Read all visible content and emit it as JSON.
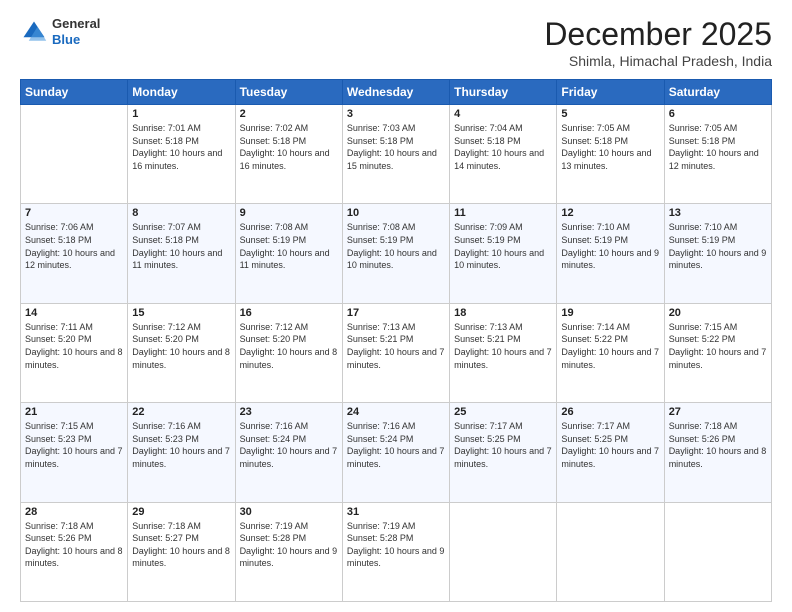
{
  "logo": {
    "general": "General",
    "blue": "Blue"
  },
  "header": {
    "month": "December 2025",
    "location": "Shimla, Himachal Pradesh, India"
  },
  "days_of_week": [
    "Sunday",
    "Monday",
    "Tuesday",
    "Wednesday",
    "Thursday",
    "Friday",
    "Saturday"
  ],
  "weeks": [
    [
      {
        "day": "",
        "sunrise": "",
        "sunset": "",
        "daylight": ""
      },
      {
        "day": "1",
        "sunrise": "Sunrise: 7:01 AM",
        "sunset": "Sunset: 5:18 PM",
        "daylight": "Daylight: 10 hours and 16 minutes."
      },
      {
        "day": "2",
        "sunrise": "Sunrise: 7:02 AM",
        "sunset": "Sunset: 5:18 PM",
        "daylight": "Daylight: 10 hours and 16 minutes."
      },
      {
        "day": "3",
        "sunrise": "Sunrise: 7:03 AM",
        "sunset": "Sunset: 5:18 PM",
        "daylight": "Daylight: 10 hours and 15 minutes."
      },
      {
        "day": "4",
        "sunrise": "Sunrise: 7:04 AM",
        "sunset": "Sunset: 5:18 PM",
        "daylight": "Daylight: 10 hours and 14 minutes."
      },
      {
        "day": "5",
        "sunrise": "Sunrise: 7:05 AM",
        "sunset": "Sunset: 5:18 PM",
        "daylight": "Daylight: 10 hours and 13 minutes."
      },
      {
        "day": "6",
        "sunrise": "Sunrise: 7:05 AM",
        "sunset": "Sunset: 5:18 PM",
        "daylight": "Daylight: 10 hours and 12 minutes."
      }
    ],
    [
      {
        "day": "7",
        "sunrise": "Sunrise: 7:06 AM",
        "sunset": "Sunset: 5:18 PM",
        "daylight": "Daylight: 10 hours and 12 minutes."
      },
      {
        "day": "8",
        "sunrise": "Sunrise: 7:07 AM",
        "sunset": "Sunset: 5:18 PM",
        "daylight": "Daylight: 10 hours and 11 minutes."
      },
      {
        "day": "9",
        "sunrise": "Sunrise: 7:08 AM",
        "sunset": "Sunset: 5:19 PM",
        "daylight": "Daylight: 10 hours and 11 minutes."
      },
      {
        "day": "10",
        "sunrise": "Sunrise: 7:08 AM",
        "sunset": "Sunset: 5:19 PM",
        "daylight": "Daylight: 10 hours and 10 minutes."
      },
      {
        "day": "11",
        "sunrise": "Sunrise: 7:09 AM",
        "sunset": "Sunset: 5:19 PM",
        "daylight": "Daylight: 10 hours and 10 minutes."
      },
      {
        "day": "12",
        "sunrise": "Sunrise: 7:10 AM",
        "sunset": "Sunset: 5:19 PM",
        "daylight": "Daylight: 10 hours and 9 minutes."
      },
      {
        "day": "13",
        "sunrise": "Sunrise: 7:10 AM",
        "sunset": "Sunset: 5:19 PM",
        "daylight": "Daylight: 10 hours and 9 minutes."
      }
    ],
    [
      {
        "day": "14",
        "sunrise": "Sunrise: 7:11 AM",
        "sunset": "Sunset: 5:20 PM",
        "daylight": "Daylight: 10 hours and 8 minutes."
      },
      {
        "day": "15",
        "sunrise": "Sunrise: 7:12 AM",
        "sunset": "Sunset: 5:20 PM",
        "daylight": "Daylight: 10 hours and 8 minutes."
      },
      {
        "day": "16",
        "sunrise": "Sunrise: 7:12 AM",
        "sunset": "Sunset: 5:20 PM",
        "daylight": "Daylight: 10 hours and 8 minutes."
      },
      {
        "day": "17",
        "sunrise": "Sunrise: 7:13 AM",
        "sunset": "Sunset: 5:21 PM",
        "daylight": "Daylight: 10 hours and 7 minutes."
      },
      {
        "day": "18",
        "sunrise": "Sunrise: 7:13 AM",
        "sunset": "Sunset: 5:21 PM",
        "daylight": "Daylight: 10 hours and 7 minutes."
      },
      {
        "day": "19",
        "sunrise": "Sunrise: 7:14 AM",
        "sunset": "Sunset: 5:22 PM",
        "daylight": "Daylight: 10 hours and 7 minutes."
      },
      {
        "day": "20",
        "sunrise": "Sunrise: 7:15 AM",
        "sunset": "Sunset: 5:22 PM",
        "daylight": "Daylight: 10 hours and 7 minutes."
      }
    ],
    [
      {
        "day": "21",
        "sunrise": "Sunrise: 7:15 AM",
        "sunset": "Sunset: 5:23 PM",
        "daylight": "Daylight: 10 hours and 7 minutes."
      },
      {
        "day": "22",
        "sunrise": "Sunrise: 7:16 AM",
        "sunset": "Sunset: 5:23 PM",
        "daylight": "Daylight: 10 hours and 7 minutes."
      },
      {
        "day": "23",
        "sunrise": "Sunrise: 7:16 AM",
        "sunset": "Sunset: 5:24 PM",
        "daylight": "Daylight: 10 hours and 7 minutes."
      },
      {
        "day": "24",
        "sunrise": "Sunrise: 7:16 AM",
        "sunset": "Sunset: 5:24 PM",
        "daylight": "Daylight: 10 hours and 7 minutes."
      },
      {
        "day": "25",
        "sunrise": "Sunrise: 7:17 AM",
        "sunset": "Sunset: 5:25 PM",
        "daylight": "Daylight: 10 hours and 7 minutes."
      },
      {
        "day": "26",
        "sunrise": "Sunrise: 7:17 AM",
        "sunset": "Sunset: 5:25 PM",
        "daylight": "Daylight: 10 hours and 7 minutes."
      },
      {
        "day": "27",
        "sunrise": "Sunrise: 7:18 AM",
        "sunset": "Sunset: 5:26 PM",
        "daylight": "Daylight: 10 hours and 8 minutes."
      }
    ],
    [
      {
        "day": "28",
        "sunrise": "Sunrise: 7:18 AM",
        "sunset": "Sunset: 5:26 PM",
        "daylight": "Daylight: 10 hours and 8 minutes."
      },
      {
        "day": "29",
        "sunrise": "Sunrise: 7:18 AM",
        "sunset": "Sunset: 5:27 PM",
        "daylight": "Daylight: 10 hours and 8 minutes."
      },
      {
        "day": "30",
        "sunrise": "Sunrise: 7:19 AM",
        "sunset": "Sunset: 5:28 PM",
        "daylight": "Daylight: 10 hours and 9 minutes."
      },
      {
        "day": "31",
        "sunrise": "Sunrise: 7:19 AM",
        "sunset": "Sunset: 5:28 PM",
        "daylight": "Daylight: 10 hours and 9 minutes."
      },
      {
        "day": "",
        "sunrise": "",
        "sunset": "",
        "daylight": ""
      },
      {
        "day": "",
        "sunrise": "",
        "sunset": "",
        "daylight": ""
      },
      {
        "day": "",
        "sunrise": "",
        "sunset": "",
        "daylight": ""
      }
    ]
  ]
}
